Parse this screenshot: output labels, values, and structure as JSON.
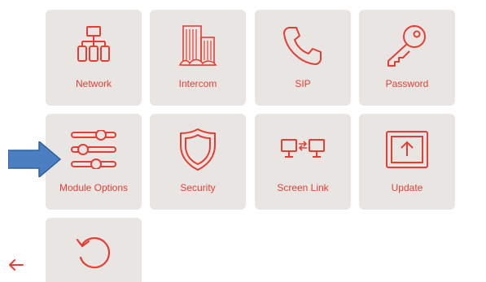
{
  "accent_color": "#e43f35",
  "tile_background": "#e8e5e3",
  "tiles": [
    {
      "label": "Network",
      "icon": "network-icon"
    },
    {
      "label": "Intercom",
      "icon": "building-icon"
    },
    {
      "label": "SIP",
      "icon": "phone-icon"
    },
    {
      "label": "Password",
      "icon": "key-icon"
    },
    {
      "label": "Module Options",
      "icon": "sliders-icon"
    },
    {
      "label": "Security",
      "icon": "shield-icon"
    },
    {
      "label": "Screen Link",
      "icon": "screen-link-icon"
    },
    {
      "label": "Update",
      "icon": "update-icon"
    },
    {
      "label": "",
      "icon": "reset-icon"
    }
  ],
  "back_icon": "arrow-left-icon",
  "annotation": {
    "icon": "pointer-arrow",
    "color": "#4a7fc1"
  }
}
